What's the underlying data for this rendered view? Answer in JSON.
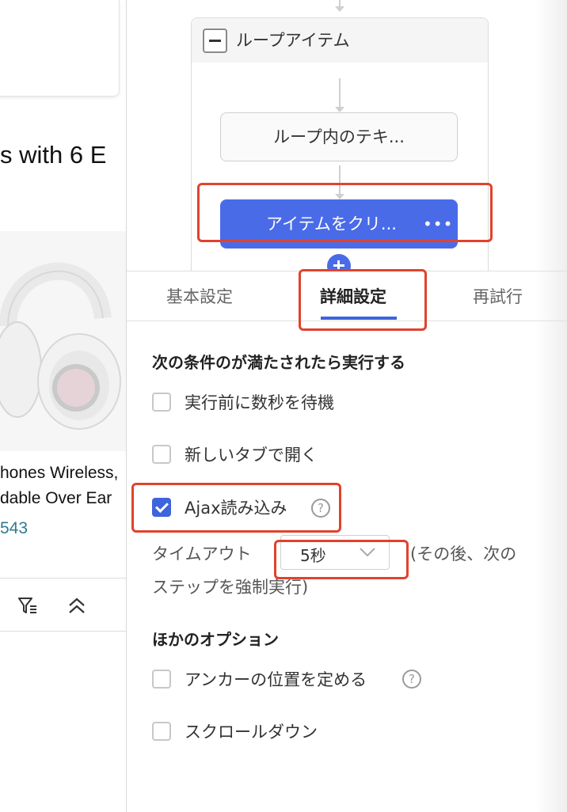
{
  "left_page": {
    "heading_fragment": "s with 6 E",
    "product_title_line1": "hones Wireless,",
    "product_title_line2": "dable Over Ear",
    "rating_count": "543"
  },
  "flow": {
    "loop_title": "ループアイテム",
    "step_loop_text": "ループ内のテキ...",
    "step_click_item": "アイテムをクリ...",
    "more_label": "•••"
  },
  "tabs": [
    {
      "label": "基本設定",
      "active": false
    },
    {
      "label": "詳細設定",
      "active": true
    },
    {
      "label": "再試行",
      "active": false
    }
  ],
  "conditions": {
    "title": "次の条件のが満たされたら実行する",
    "wait_before": {
      "label": "実行前に数秒を待機",
      "checked": false
    },
    "open_new_tab": {
      "label": "新しいタブで開く",
      "checked": false
    },
    "ajax_load": {
      "label": "Ajax読み込み",
      "checked": true,
      "help": "?"
    },
    "timeout": {
      "label": "タイムアウト",
      "value": "5秒",
      "suffix_line1": "(その後、次の",
      "suffix_line2": "ステップを強制実行)"
    }
  },
  "other_options": {
    "title": "ほかのオプション",
    "anchor": {
      "label": "アンカーの位置を定める",
      "checked": false,
      "help": "?"
    },
    "scroll_down": {
      "label": "スクロールダウン",
      "checked": false
    }
  },
  "colors": {
    "accent": "#3e63dd",
    "annotation": "#e0432c",
    "rating_link": "#2f7a8f"
  },
  "icons": [
    "filter-icon",
    "chevron-up-icon",
    "collapse-icon",
    "plus-icon",
    "help-icon",
    "chevron-down-icon",
    "checkmark-icon"
  ]
}
